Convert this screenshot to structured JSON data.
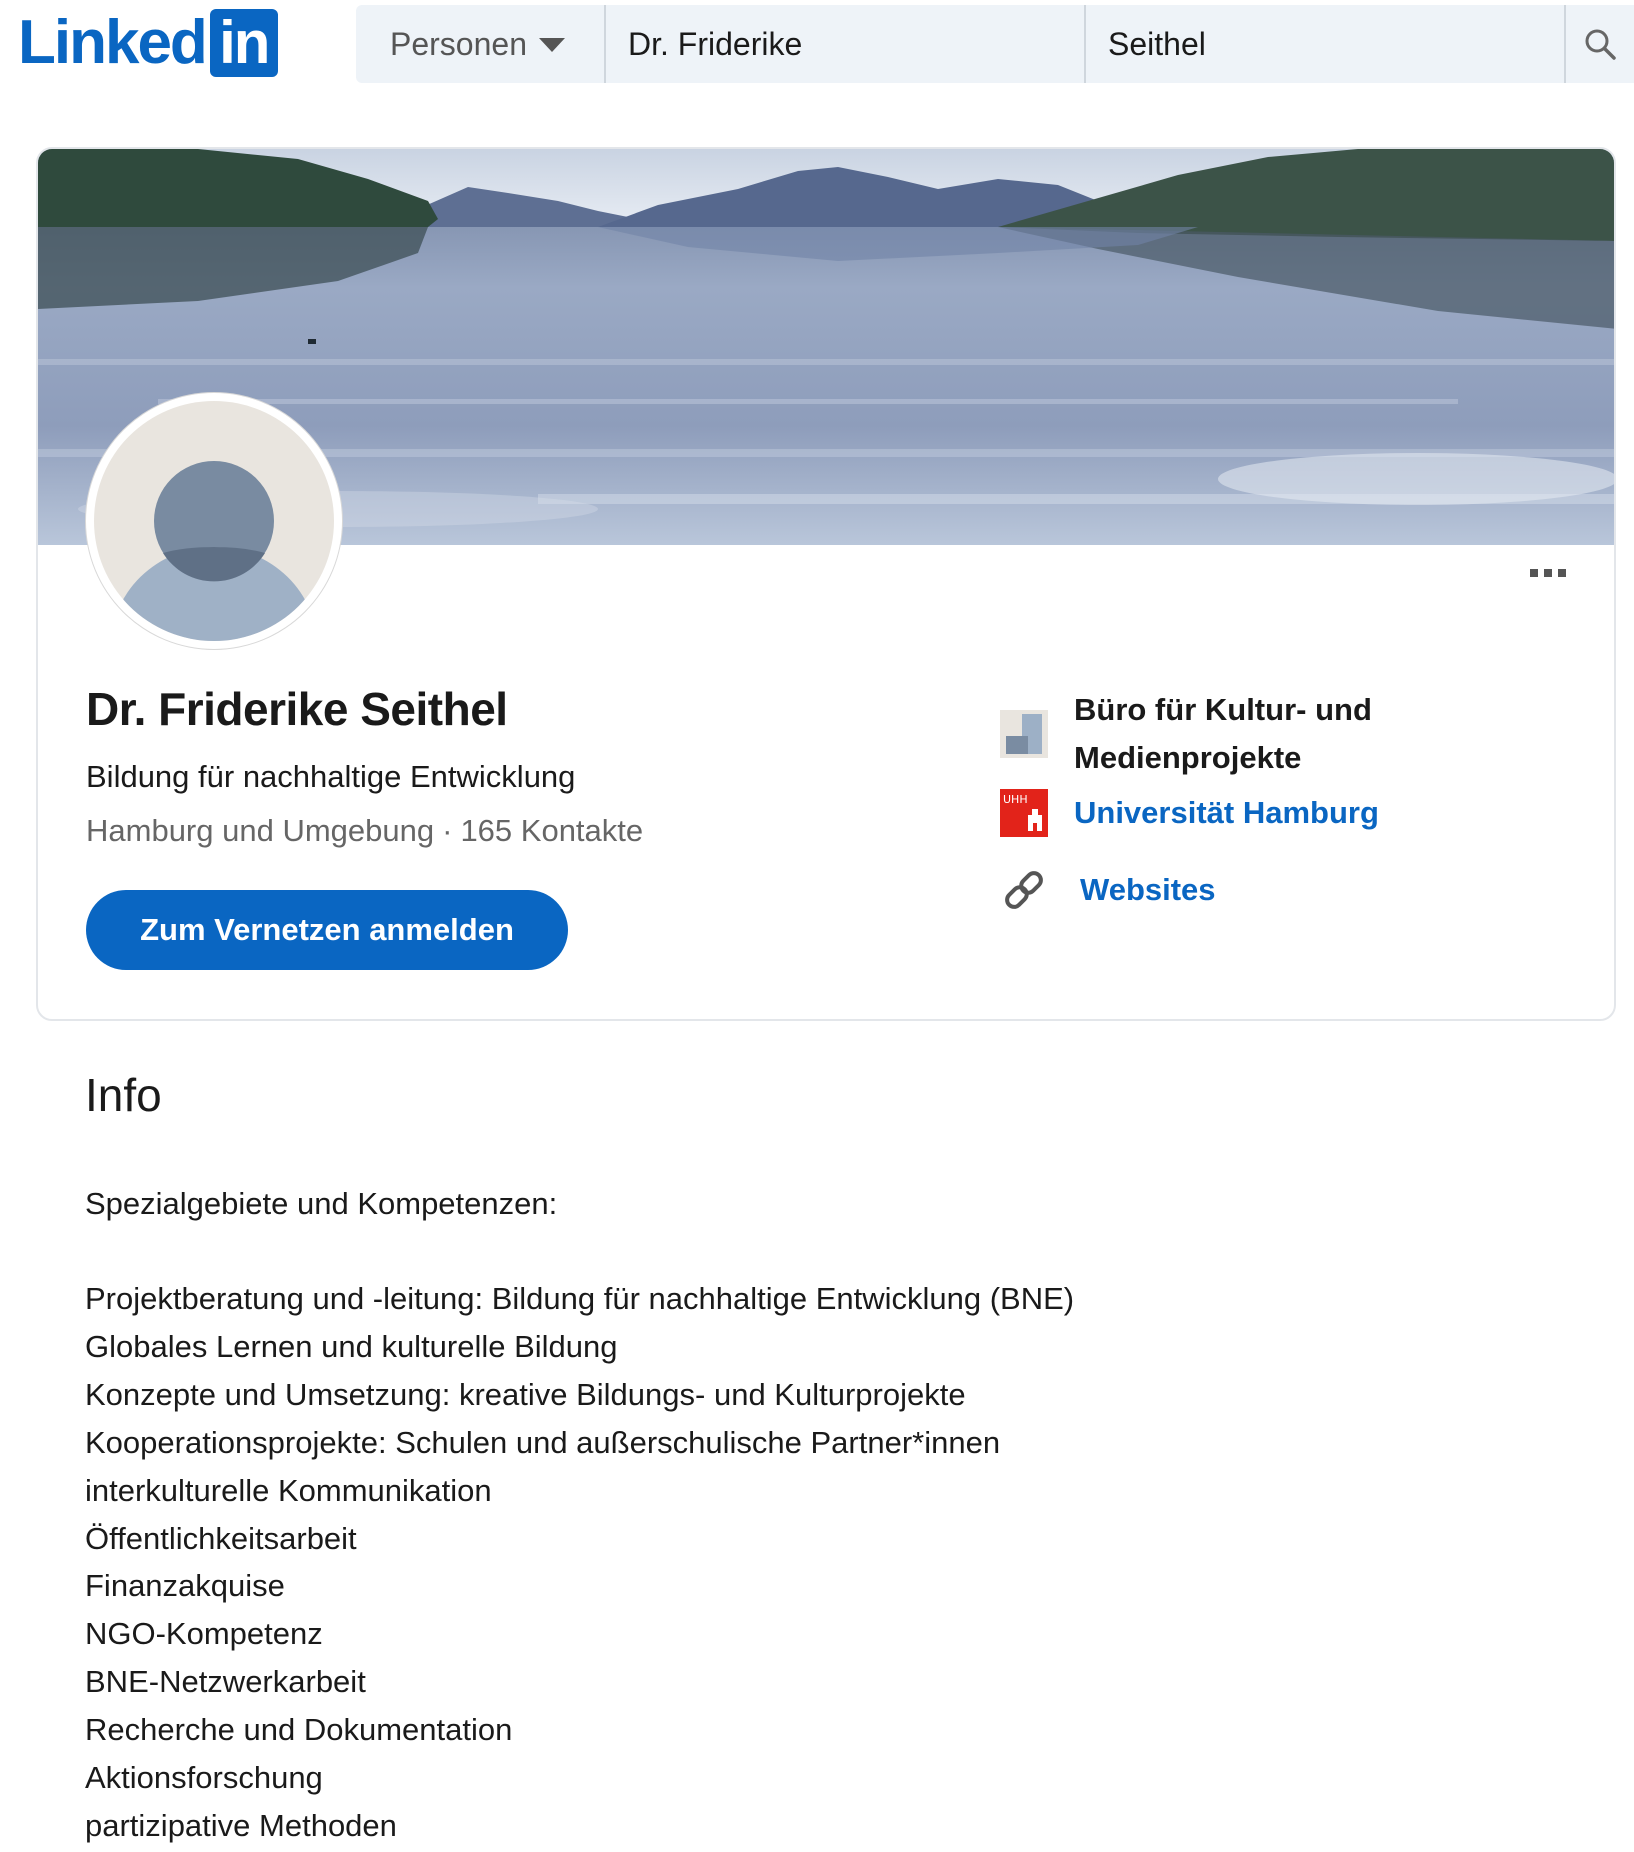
{
  "brand": {
    "logo_text": "Linked",
    "logo_box_text": "in",
    "color": "#0a66c2"
  },
  "search": {
    "type_label": "Personen",
    "first_name": "Dr. Friderike",
    "last_name": "Seithel",
    "search_icon": "search-icon"
  },
  "profile": {
    "name": "Dr. Friderike Seithel",
    "headline": "Bildung für nachhaltige Entwicklung",
    "location": "Hamburg und Umgebung",
    "separator": "·",
    "contacts": "165 Kontakte",
    "connect_label": "Zum Vernetzen anmelden",
    "more_icon": "more-icon"
  },
  "sidebar": {
    "company": "Büro für Kultur- und Medienprojekte",
    "education": "Universität Hamburg",
    "education_logo_text": "UHH",
    "websites": "Websites"
  },
  "info": {
    "title": "Info",
    "intro": "Spezialgebiete und Kompetenzen:",
    "items": [
      "Projektberatung und -leitung: Bildung für nachhaltige Entwicklung (BNE)",
      "Globales Lernen und kulturelle Bildung",
      "Konzepte und Umsetzung: kreative Bildungs- und Kulturprojekte",
      "Kooperationsprojekte: Schulen und außerschulische Partner*innen",
      "interkulturelle Kommunikation",
      "Öffentlichkeitsarbeit",
      "Finanzakquise",
      "NGO-Kompetenz",
      "BNE-Netzwerkarbeit",
      "Recherche und Dokumentation",
      "Aktionsforschung",
      "partizipative Methoden"
    ]
  }
}
